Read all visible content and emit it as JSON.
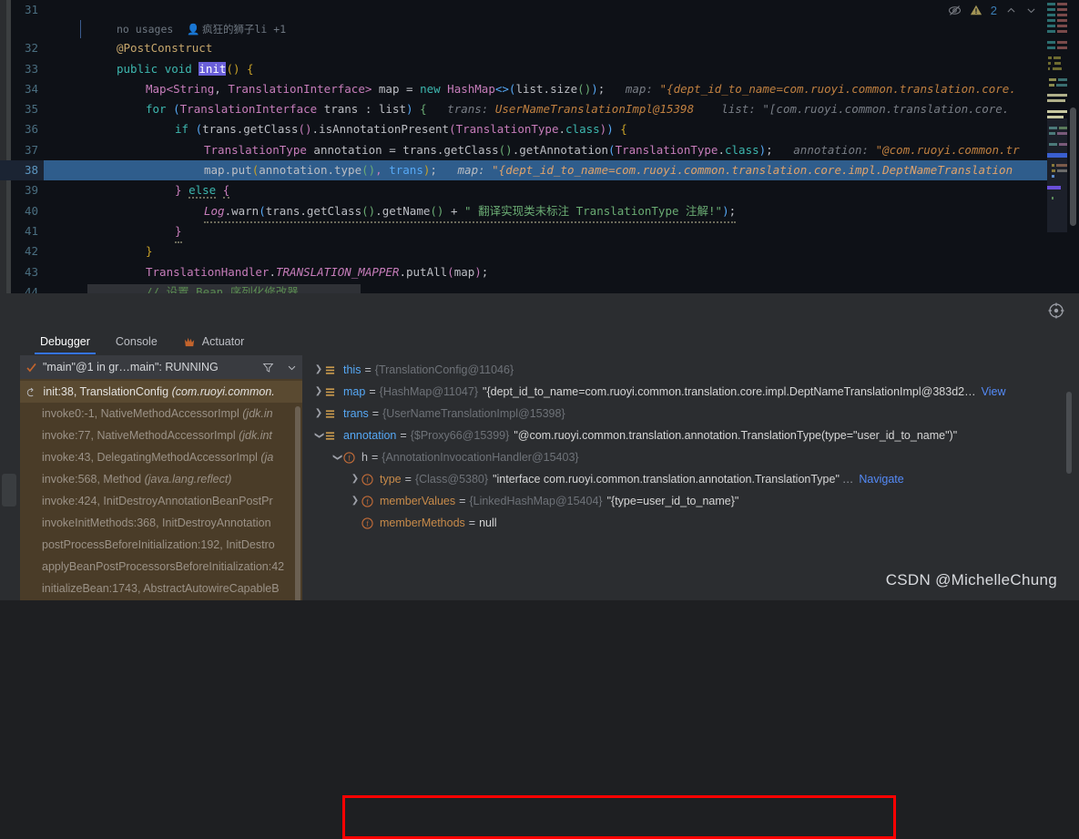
{
  "editor": {
    "usage_hint": {
      "text": "no usages",
      "author": "疯狂的狮子li +1",
      "author_icon": "person-icon"
    },
    "lines": [
      {
        "num": "31",
        "text": ""
      },
      {
        "num": "32",
        "text": "@PostConstruct"
      },
      {
        "num": "33",
        "text": "public void init() {"
      },
      {
        "num": "34",
        "text": "Map<String, TranslationInterface> map = new HashMap<>(list.size());",
        "hint": "map: \"{dept_id_to_name=com.ruoyi.common.translation.core."
      },
      {
        "num": "35",
        "text": "for (TranslationInterface trans : list) {",
        "hint": "trans: UserNameTranslationImpl@15398    list: \"[com.ruoyi.common.translation.core."
      },
      {
        "num": "36",
        "text": "if (trans.getClass().isAnnotationPresent(TranslationType.class)) {"
      },
      {
        "num": "37",
        "text": "TranslationType annotation = trans.getClass().getAnnotation(TranslationType.class);",
        "hint": "annotation: \"@com.ruoyi.common.tr"
      },
      {
        "num": "38",
        "text": "map.put(annotation.type(), trans);",
        "hint": "map: \"{dept_id_to_name=com.ruoyi.common.translation.core.impl.DeptNameTranslation",
        "highlighted": true
      },
      {
        "num": "39",
        "text": "} else {"
      },
      {
        "num": "40",
        "text": "Log.warn(trans.getClass().getName() + \" 翻译实现类未标注 TranslationType 注解!\");"
      },
      {
        "num": "41",
        "text": "}"
      },
      {
        "num": "42",
        "text": "}"
      },
      {
        "num": "43",
        "text": "TranslationHandler.TRANSLATION_MAPPER.putAll(map);"
      },
      {
        "num": "44",
        "text": "// 设置 Bean 序列化修改器"
      }
    ],
    "inspection": {
      "eye_icon": "eye-crossed-icon",
      "warning_icon": "warning-triangle-icon",
      "warning_count": "2",
      "prev_icon": "chevron-up-icon",
      "next_icon": "chevron-down-icon"
    },
    "crosshair_icon": "crosshair-target-icon"
  },
  "debug": {
    "tabs": [
      {
        "label": "Debugger",
        "active": true,
        "icon": ""
      },
      {
        "label": "Console",
        "active": false,
        "icon": ""
      },
      {
        "label": "Actuator",
        "active": false,
        "icon": "actuator-icon"
      }
    ],
    "thread_selector": {
      "check_icon": "check-mark-icon",
      "label": "\"main\"@1 in gr…main\": RUNNING",
      "filter_icon": "filter-funnel-icon",
      "dropdown_icon": "chevron-down-icon"
    },
    "frames": [
      {
        "label": "init:38, TranslationConfig",
        "pkg": "(com.ruoyi.common.",
        "selected": true,
        "icon": "return-arrow-icon"
      },
      {
        "label": "invoke0:-1, NativeMethodAccessorImpl",
        "pkg": "(jdk.in"
      },
      {
        "label": "invoke:77, NativeMethodAccessorImpl",
        "pkg": "(jdk.int"
      },
      {
        "label": "invoke:43, DelegatingMethodAccessorImpl",
        "pkg": "(ja"
      },
      {
        "label": "invoke:568, Method",
        "pkg": "(java.lang.reflect)"
      },
      {
        "label": "invoke:424, InitDestroyAnnotationBeanPostPr",
        "pkg": ""
      },
      {
        "label": "invokeInitMethods:368, InitDestroyAnnotation",
        "pkg": ""
      },
      {
        "label": "postProcessBeforeInitialization:192, InitDestro",
        "pkg": ""
      },
      {
        "label": "applyBeanPostProcessorsBeforeInitialization:42",
        "pkg": ""
      },
      {
        "label": "initializeBean:1743, AbstractAutowireCapableB",
        "pkg": ""
      }
    ],
    "variables": [
      {
        "indent": 0,
        "arrow": "collapsed",
        "icon": "variable-icon",
        "kind": "var",
        "name": "this",
        "type": "{TranslationConfig@11046}",
        "value": "",
        "link": ""
      },
      {
        "indent": 0,
        "arrow": "collapsed",
        "icon": "variable-icon",
        "kind": "var",
        "name": "map",
        "type": "{HashMap@11047}",
        "value": "\"{dept_id_to_name=com.ruoyi.common.translation.core.impl.DeptNameTranslationImpl@383d2…",
        "link": "View"
      },
      {
        "indent": 0,
        "arrow": "collapsed",
        "icon": "variable-icon",
        "kind": "var",
        "name": "trans",
        "type": "{UserNameTranslationImpl@15398}",
        "value": "",
        "link": ""
      },
      {
        "indent": 0,
        "arrow": "expanded",
        "icon": "variable-icon",
        "kind": "var",
        "name": "annotation",
        "type": "{$Proxy66@15399}",
        "value": "\"@com.ruoyi.common.translation.annotation.TranslationType(type=\"user_id_to_name\")\"",
        "link": ""
      },
      {
        "indent": 1,
        "arrow": "expanded",
        "icon": "field-icon",
        "kind": "field",
        "name": "h",
        "type": "{AnnotationInvocationHandler@15403}",
        "value": "",
        "link": ""
      },
      {
        "indent": 2,
        "arrow": "collapsed",
        "icon": "field-icon",
        "kind": "field",
        "name": "type",
        "type": "{Class@5380}",
        "value": "\"interface com.ruoyi.common.translation.annotation.TranslationType\"",
        "dots": "…",
        "link": "Navigate"
      },
      {
        "indent": 2,
        "arrow": "collapsed",
        "icon": "field-icon",
        "kind": "field",
        "name": "memberValues",
        "type": "{LinkedHashMap@15404}",
        "value": "\"{type=user_id_to_name}\"",
        "link": ""
      },
      {
        "indent": 2,
        "arrow": "none",
        "icon": "field-icon",
        "kind": "field",
        "name": "memberMethods",
        "type": "",
        "value": "null",
        "link": ""
      }
    ],
    "highlight_box_color": "#FF0000"
  },
  "watermark": "CSDN @MichelleChung",
  "colors": {
    "editor_bg": "#0E1117",
    "panel_bg": "#2B2D30",
    "frames_bg": "#4A3C28",
    "accent_blue": "#3574F0",
    "selection_blue": "#2F5D8C",
    "link_blue": "#548AF7"
  }
}
